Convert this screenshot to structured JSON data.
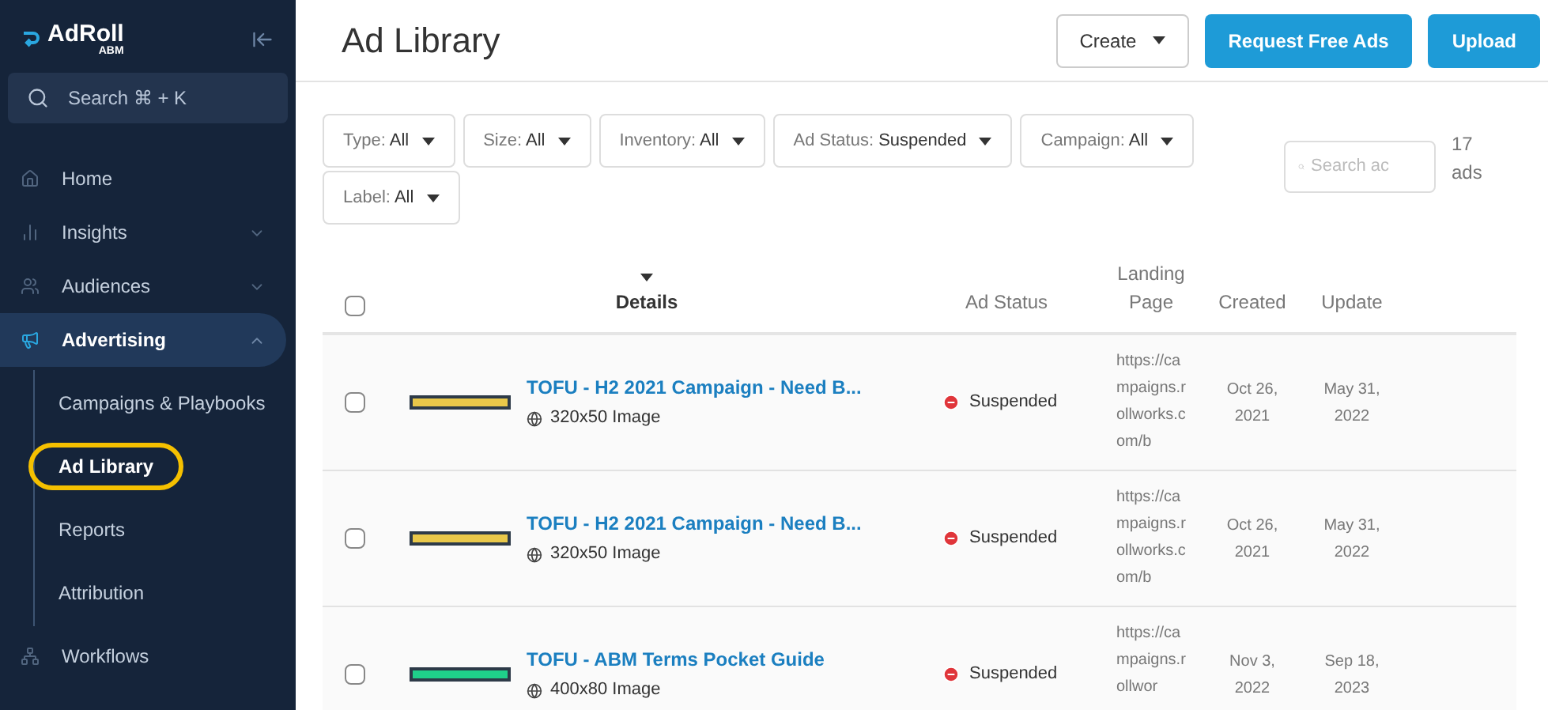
{
  "sidebar": {
    "logo": "AdRoll",
    "logo_sub": "ABM",
    "search": "Search ⌘ + K",
    "items": [
      {
        "label": "Home",
        "expandable": false,
        "selected": false
      },
      {
        "label": "Insights",
        "expandable": true,
        "expanded": false,
        "selected": false
      },
      {
        "label": "Audiences",
        "expandable": true,
        "expanded": false,
        "selected": false
      },
      {
        "label": "Advertising",
        "expandable": true,
        "expanded": true,
        "selected": true,
        "children": [
          {
            "label": "Campaigns & Playbooks",
            "selected": false
          },
          {
            "label": "Ad Library",
            "selected": true
          },
          {
            "label": "Reports",
            "selected": false
          },
          {
            "label": "Attribution",
            "selected": false
          }
        ]
      },
      {
        "label": "Workflows",
        "expandable": false,
        "selected": false
      }
    ]
  },
  "header": {
    "title": "Ad Library",
    "buttons": [
      {
        "label": "Create",
        "kind": "dropdown"
      },
      {
        "label": "Request Free Ads",
        "kind": "primary"
      },
      {
        "label": "Upload",
        "kind": "primary"
      }
    ]
  },
  "filters": [
    {
      "label": "Type:",
      "value": "All"
    },
    {
      "label": "Size:",
      "value": "All"
    },
    {
      "label": "Inventory:",
      "value": "All"
    },
    {
      "label": "Ad Status:",
      "value": "Suspended"
    },
    {
      "label": "Campaign:",
      "value": "All"
    },
    {
      "label": "Label:",
      "value": "All"
    }
  ],
  "search": {
    "placeholder": "Search ac"
  },
  "count": "17 ads",
  "table": {
    "select_all_checked": false,
    "columns": [
      {
        "label": "Details",
        "sorted": true
      },
      {
        "label": "Ad Status",
        "sorted": false
      },
      {
        "label": "Landing Page",
        "sorted": false
      },
      {
        "label": "Created",
        "sorted": false
      },
      {
        "label": "Update",
        "sorted": false
      }
    ],
    "rows": [
      {
        "checked": false,
        "color": "#e9c84a",
        "title": "TOFU - H2 2021 Campaign - Need B...",
        "size": "320x50 Image",
        "status": "Suspended",
        "landing": "https://campaigns.rollworks.com/b",
        "created": "Oct 26, 2021",
        "updated": "May 31, 2022"
      },
      {
        "checked": false,
        "color": "#e9c84a",
        "title": "TOFU - H2 2021 Campaign - Need B...",
        "size": "320x50 Image",
        "status": "Suspended",
        "landing": "https://campaigns.rollworks.com/b",
        "created": "Oct 26, 2021",
        "updated": "May 31, 2022"
      },
      {
        "checked": false,
        "color": "#1fd08a",
        "title": "TOFU - ABM Terms Pocket Guide",
        "size": "400x80 Image",
        "status": "Suspended",
        "landing": "https://campaigns.rollwor",
        "created": "Nov 3, 2022",
        "updated": "Sep 18, 2023"
      }
    ]
  }
}
